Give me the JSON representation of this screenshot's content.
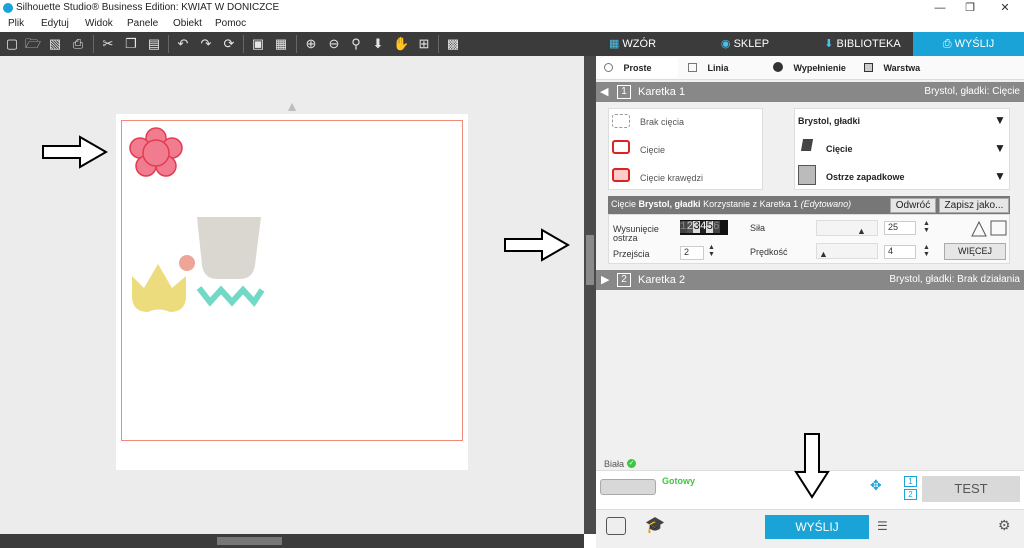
{
  "window": {
    "title": "Silhouette Studio® Business Edition: KWIAT W DONICZCE"
  },
  "menu": {
    "items": [
      "Plik",
      "Edytuj",
      "Widok",
      "Panele",
      "Obiekt",
      "Pomoc"
    ]
  },
  "tabs": {
    "items": [
      "WZÓR",
      "SKLEP",
      "BIBLIOTEKA",
      "WYŚLIJ"
    ],
    "active": "WYŚLIJ"
  },
  "subtabs": {
    "items": [
      "Proste",
      "Linia",
      "Wypełnienie",
      "Warstwa"
    ]
  },
  "carriage1": {
    "label": "Karetka 1",
    "number": "1",
    "summary": "Brystol, gładki: Cięcie"
  },
  "cut_options": {
    "items": [
      "Brak cięcia",
      "Cięcie",
      "Cięcie krawędzi"
    ]
  },
  "material": {
    "name": "Brystol, gładki",
    "action": "Cięcie",
    "tool": "Ostrze zapadkowe"
  },
  "settings_bar": {
    "prefix": "Cięcie",
    "material": "Brystol, gładki",
    "middle": "Korzystanie z Karetka 1",
    "status": "(Edytowano)",
    "reset": "Odwróć",
    "save": "Zapisz jako..."
  },
  "settings": {
    "blade_label": "Wysunięcie ostrza",
    "blade_digits": [
      "1",
      "2",
      "3",
      "4",
      "5",
      "6"
    ],
    "passes_label": "Przejścia",
    "passes_value": "2",
    "force_label": "Siła",
    "force_value": "25",
    "speed_label": "Prędkość",
    "speed_value": "4",
    "more": "WIĘCEJ"
  },
  "carriage2": {
    "label": "Karetka 2",
    "number": "2",
    "summary": "Brystol, gładki: Brak działania"
  },
  "device": {
    "name": "Biała",
    "status": "Gotowy",
    "status_color": "#3fc63f"
  },
  "buttons": {
    "test": "TEST",
    "send": "WYŚLIJ"
  },
  "colors": {
    "accent": "#1aa3d6",
    "flower": "#f17c8f",
    "yellow": "#ecdc7e",
    "pot": "#dad7d0",
    "teal": "#72d9c6",
    "dot": "#eea597"
  },
  "icons": {
    "toolbar": [
      "new-file-icon",
      "open-folder-icon",
      "save-icon",
      "print-icon",
      "cut-icon",
      "copy-icon",
      "paste-icon",
      "undo-icon",
      "redo-icon",
      "refresh-icon",
      "group-icon",
      "ungroup-icon",
      "zoom-in-icon",
      "zoom-out-icon",
      "zoom-fit-icon",
      "move-down-icon",
      "hand-icon",
      "add-page-icon",
      "pattern-icon"
    ]
  }
}
